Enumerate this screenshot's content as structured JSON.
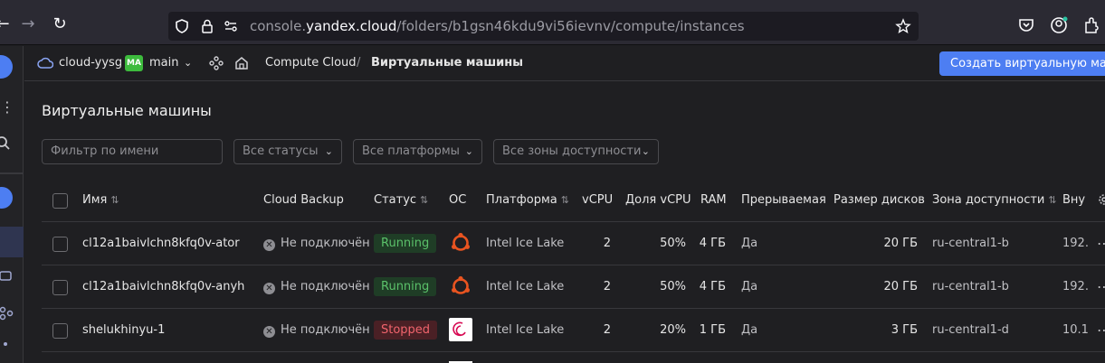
{
  "browser": {
    "url_prefix": "console.",
    "url_domain": "yandex.cloud",
    "url_path": "/folders/b1gsn46kdu9vi56ievnv/compute/instances"
  },
  "header": {
    "cloud": "cloud-yysg",
    "folder_badge": "MA",
    "folder": "main",
    "breadcrumb_service": "Compute Cloud",
    "breadcrumb_sep": "/",
    "breadcrumb_current": "Виртуальные машины",
    "create_button": "Создать виртуальную машину"
  },
  "page": {
    "title": "Виртуальные машины",
    "filter_placeholder": "Фильтр по имени",
    "status_select": "Все статусы",
    "platform_select": "Все платформы",
    "zone_select": "Все зоны доступности"
  },
  "table": {
    "columns": {
      "name": "Имя",
      "backup": "Cloud Backup",
      "status": "Статус",
      "os": "ОС",
      "platform": "Платформа",
      "vcpu": "vCPU",
      "share": "Доля vCPU",
      "ram": "RAM",
      "preempt": "Прерываемая",
      "disk": "Размер дисков",
      "zone": "Зона доступности",
      "ip": "Вну"
    },
    "rows": [
      {
        "name": "cl12a1baivlchn8kfq0v-ator",
        "backup": "Не подключён",
        "status": "Running",
        "os": "ubuntu",
        "platform": "Intel Ice Lake",
        "vcpu": "2",
        "share": "50%",
        "ram": "4 ГБ",
        "preempt": "Да",
        "disk": "20 ГБ",
        "zone": "ru-central1-b",
        "ip": "192."
      },
      {
        "name": "cl12a1baivlchn8kfq0v-anyh",
        "backup": "Не подключён",
        "status": "Running",
        "os": "ubuntu",
        "platform": "Intel Ice Lake",
        "vcpu": "2",
        "share": "50%",
        "ram": "4 ГБ",
        "preempt": "Да",
        "disk": "20 ГБ",
        "zone": "ru-central1-b",
        "ip": "192."
      },
      {
        "name": "shelukhinyu-1",
        "backup": "Не подключён",
        "status": "Stopped",
        "os": "debian",
        "platform": "Intel Ice Lake",
        "vcpu": "2",
        "share": "20%",
        "ram": "1 ГБ",
        "preempt": "Да",
        "disk": "3 ГБ",
        "zone": "ru-central1-d",
        "ip": "10.1"
      }
    ]
  },
  "colors": {
    "accent": "#4d7ef2",
    "running": "#5bc16a",
    "stopped": "#f1646d",
    "ubuntu": "#e95420",
    "debian": "#d70a53"
  }
}
